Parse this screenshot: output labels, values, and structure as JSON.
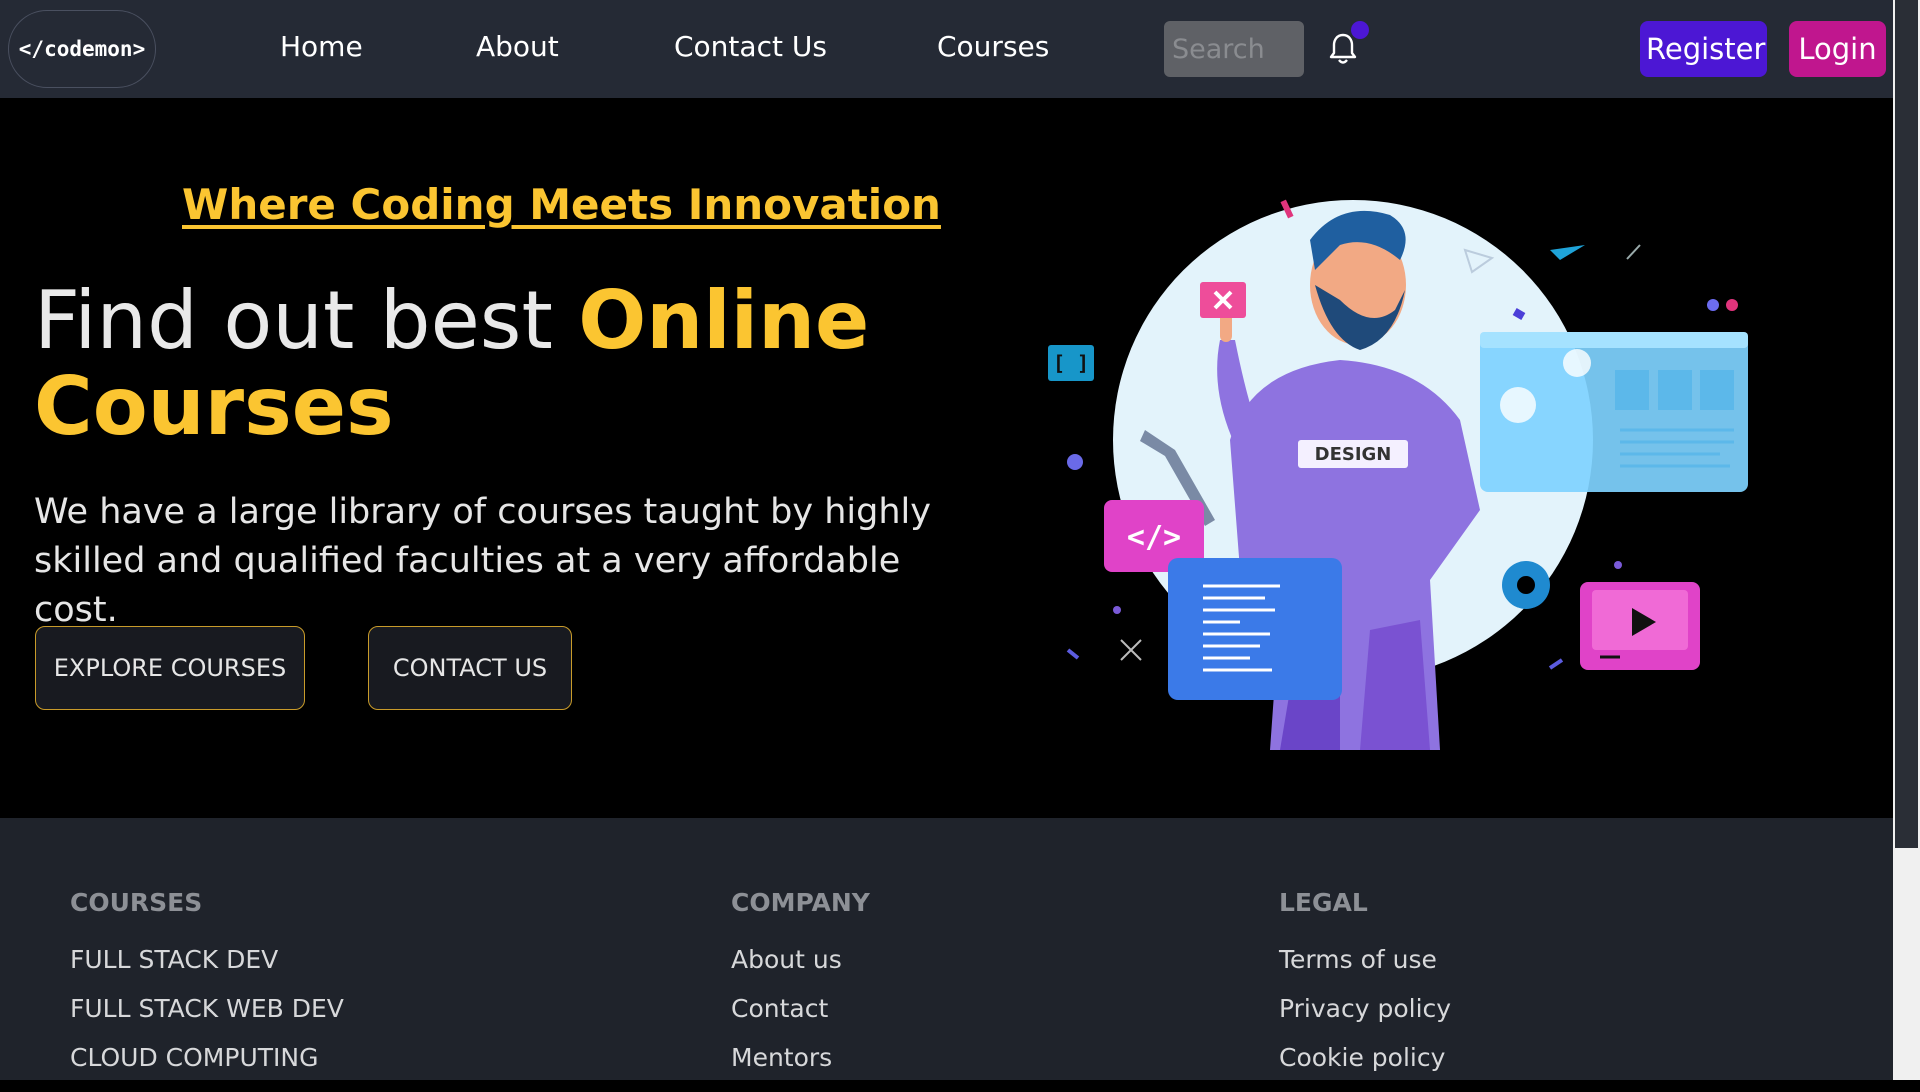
{
  "navbar": {
    "logo": "</codemon>",
    "links": [
      "Home",
      "About",
      "Contact Us",
      "Courses"
    ],
    "search_placeholder": "Search",
    "register_label": "Register",
    "login_label": "Login",
    "accent_colors": {
      "register": "#4c17d4",
      "login": "#c0168e"
    }
  },
  "hero": {
    "tagline": "Where Coding Meets Innovation",
    "title_plain": "Find out best ",
    "title_highlight": "Online Courses",
    "description": "We have a large library of courses taught by highly skilled and qualified faculties at a very affordable cost.",
    "explore_button": "EXPLORE COURSES",
    "contact_button": "CONTACT US",
    "illustration_badge": "DESIGN",
    "illustration_code_tag": "</>",
    "illustration_bracket_tag": "[ ]",
    "highlight_color": "#fbc531"
  },
  "footer": {
    "columns": [
      {
        "heading": "COURSES",
        "links": [
          "FULL STACK DEV",
          "FULL STACK WEB DEV",
          "CLOUD COMPUTING"
        ]
      },
      {
        "heading": "COMPANY",
        "links": [
          "About us",
          "Contact",
          "Mentors"
        ]
      },
      {
        "heading": "LEGAL",
        "links": [
          "Terms of use",
          "Privacy policy",
          "Cookie policy"
        ]
      }
    ]
  }
}
